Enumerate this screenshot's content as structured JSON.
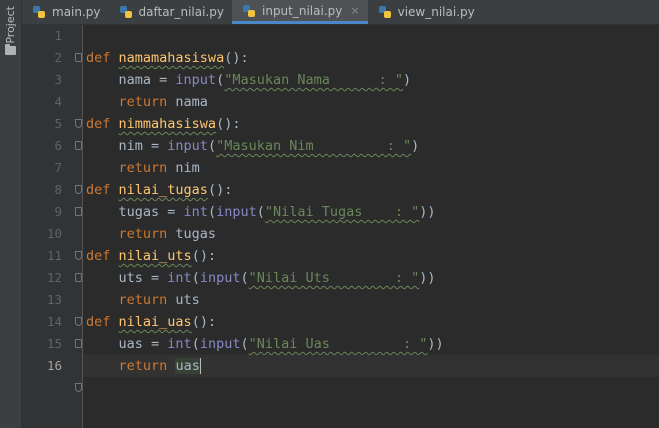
{
  "sidebar": {
    "project_label": "Project"
  },
  "tabs": [
    {
      "label": "main.py",
      "active": false
    },
    {
      "label": "daftar_nilai.py",
      "active": false
    },
    {
      "label": "input_nilai.py",
      "active": true
    },
    {
      "label": "view_nilai.py",
      "active": false
    }
  ],
  "tab_close_glyph": "×",
  "line_numbers": [
    "1",
    "2",
    "3",
    "4",
    "5",
    "6",
    "7",
    "8",
    "9",
    "10",
    "11",
    "12",
    "13",
    "14",
    "15",
    "16"
  ],
  "current_line": "16",
  "code": {
    "l2": {
      "kw": "def",
      "name": "namamahasiswa",
      "tail": "():"
    },
    "l3": {
      "var": "nama",
      "op": " = ",
      "bi": "input",
      "open": "(",
      "str": "\"Masukan Nama      : \"",
      "close": ")"
    },
    "l4": {
      "kw": "return",
      "val": " nama"
    },
    "l5": {
      "kw": "def",
      "name": "nimmahasiswa",
      "tail": "():"
    },
    "l6": {
      "var": "nim",
      "op": " = ",
      "bi": "input",
      "open": "(",
      "str": "\"Masukan Nim         : \"",
      "close": ")"
    },
    "l7": {
      "kw": "return",
      "val": " nim"
    },
    "l8": {
      "kw": "def",
      "name": "nilai_tugas",
      "tail": "():"
    },
    "l9": {
      "var": "tugas",
      "op": " = ",
      "bi1": "int",
      "open1": "(",
      "bi2": "input",
      "open2": "(",
      "str": "\"Nilai Tugas    : \"",
      "close": "))"
    },
    "l10": {
      "kw": "return",
      "val": " tugas"
    },
    "l11": {
      "kw": "def",
      "name": "nilai_uts",
      "tail": "():"
    },
    "l12": {
      "var": "uts",
      "op": " = ",
      "bi1": "int",
      "open1": "(",
      "bi2": "input",
      "open2": "(",
      "str": "\"Nilai Uts        : \"",
      "close": "))"
    },
    "l13": {
      "kw": "return",
      "val": " uts"
    },
    "l14": {
      "kw": "def",
      "name": "nilai_uas",
      "tail": "():"
    },
    "l15": {
      "var": "uas",
      "op": " = ",
      "bi1": "int",
      "open1": "(",
      "bi2": "input",
      "open2": "(",
      "str": "\"Nilai Uas         : \"",
      "close": "))"
    },
    "l16": {
      "kw": "return",
      "val": "uas"
    }
  },
  "colors": {
    "keyword": "#cc7832",
    "function": "#ffc66d",
    "builtin": "#8888c6",
    "string": "#6a8759",
    "text": "#a9b7c6"
  }
}
